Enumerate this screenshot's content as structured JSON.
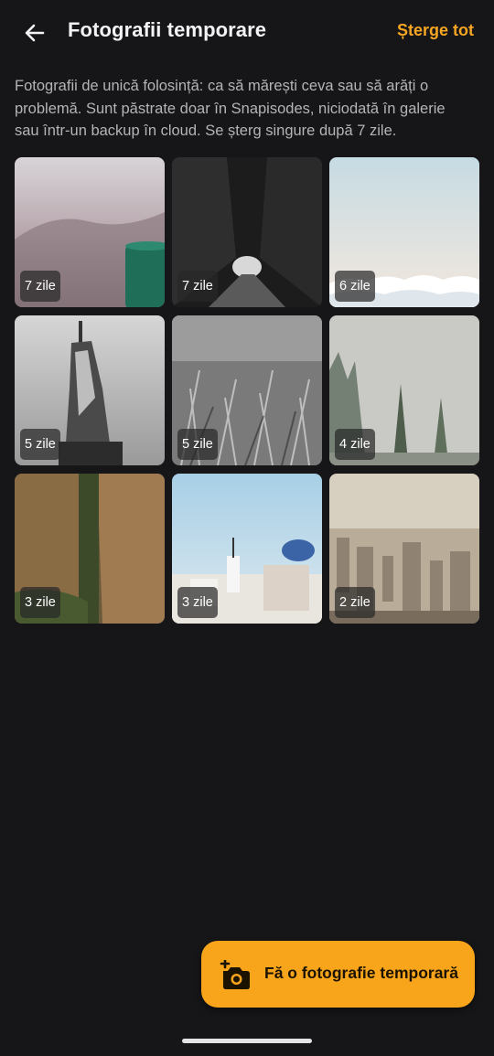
{
  "header": {
    "title": "Fotografii temporare",
    "delete_all_label": "Șterge tot",
    "back_icon": "arrow-left-icon"
  },
  "description": "Fotografii de unică folosință: ca să mărești ceva sau să arăți o problemă. Sunt păstrate doar în Snapisodes, niciodată în galerie sau într-un backup în cloud. Se șterg singure după 7 zile.",
  "photos": [
    {
      "badge": "7 zile"
    },
    {
      "badge": "7 zile"
    },
    {
      "badge": "6 zile"
    },
    {
      "badge": "5 zile"
    },
    {
      "badge": "5 zile"
    },
    {
      "badge": "4 zile"
    },
    {
      "badge": "3 zile"
    },
    {
      "badge": "3 zile"
    },
    {
      "badge": "2 zile"
    }
  ],
  "fab": {
    "label": "Fă o fotografie temporară",
    "icon": "add-camera-icon"
  },
  "colors": {
    "background": "#161618",
    "accent": "#f8a51c"
  }
}
